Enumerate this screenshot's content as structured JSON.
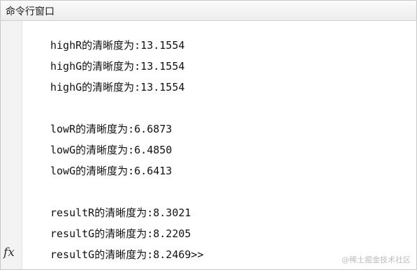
{
  "window": {
    "title": "命令行窗口"
  },
  "console": {
    "lines": [
      "highR的清晰度为:13.1554",
      "highG的清晰度为:13.1554",
      "highG的清晰度为:13.1554",
      "lowR的清晰度为:6.6873",
      "lowG的清晰度为:6.4850",
      "lowG的清晰度为:6.6413",
      "resultR的清晰度为:8.3021",
      "resultG的清晰度为:8.2205",
      "resultG的清晰度为:8.2469>>"
    ]
  },
  "prompt": {
    "fx_symbol": "fx"
  },
  "watermark": "@稀土掘金技术社区"
}
